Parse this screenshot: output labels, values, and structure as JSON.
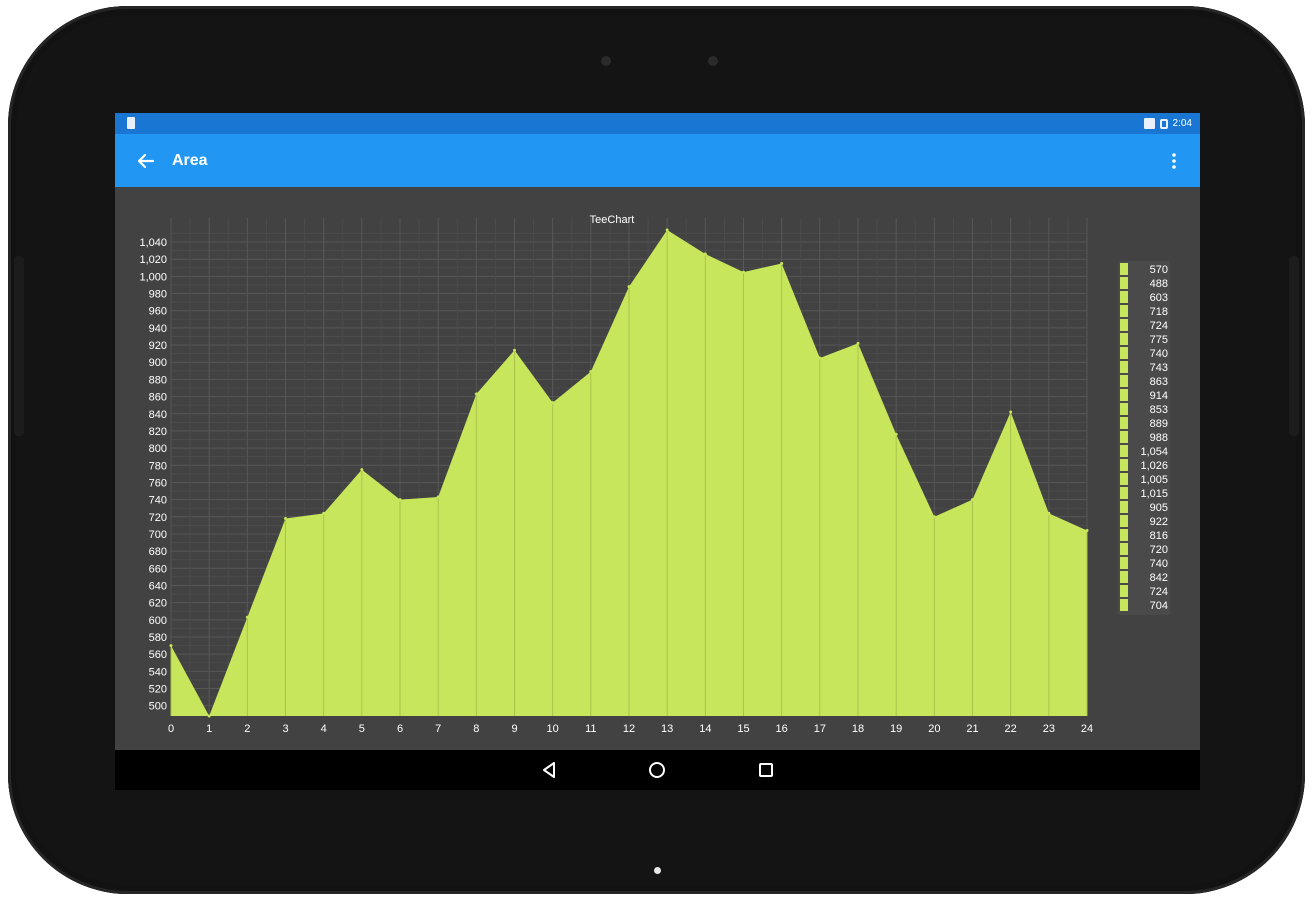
{
  "status_bar": {
    "time": "2:04"
  },
  "app_bar": {
    "title": "Area"
  },
  "colors": {
    "accent": "#2196f3",
    "status": "#1976d2",
    "series": "#c8e65c",
    "chart_bg": "#424242"
  },
  "icons": {
    "back": "arrow-back-icon",
    "menu": "more-vert-icon",
    "nav_back": "triangle-back-icon",
    "nav_home": "circle-home-icon",
    "nav_recents": "square-recents-icon"
  },
  "chart_data": {
    "type": "area",
    "title": "TeeChart",
    "x": [
      0,
      1,
      2,
      3,
      4,
      5,
      6,
      7,
      8,
      9,
      10,
      11,
      12,
      13,
      14,
      15,
      16,
      17,
      18,
      19,
      20,
      21,
      22,
      23,
      24
    ],
    "values": [
      570,
      488,
      603,
      718,
      724,
      775,
      740,
      743,
      863,
      914,
      853,
      889,
      988,
      1054,
      1026,
      1005,
      1015,
      905,
      922,
      816,
      720,
      740,
      842,
      724,
      704
    ],
    "legend_labels": [
      "570",
      "488",
      "603",
      "718",
      "724",
      "775",
      "740",
      "743",
      "863",
      "914",
      "853",
      "889",
      "988",
      "1,054",
      "1,026",
      "1,005",
      "1,015",
      "905",
      "922",
      "816",
      "720",
      "740",
      "842",
      "724",
      "704"
    ],
    "y_ticks": [
      "500",
      "520",
      "540",
      "560",
      "580",
      "600",
      "620",
      "640",
      "660",
      "680",
      "700",
      "720",
      "740",
      "760",
      "780",
      "800",
      "820",
      "840",
      "860",
      "880",
      "900",
      "920",
      "940",
      "960",
      "980",
      "1,000",
      "1,020",
      "1,040"
    ],
    "x_ticks": [
      "0",
      "1",
      "2",
      "3",
      "4",
      "5",
      "6",
      "7",
      "8",
      "9",
      "10",
      "11",
      "12",
      "13",
      "14",
      "15",
      "16",
      "17",
      "18",
      "19",
      "20",
      "21",
      "22",
      "23",
      "24"
    ],
    "xlim": [
      0,
      24
    ],
    "ylim": [
      488,
      1054
    ],
    "grid": true,
    "legend_position": "right"
  }
}
